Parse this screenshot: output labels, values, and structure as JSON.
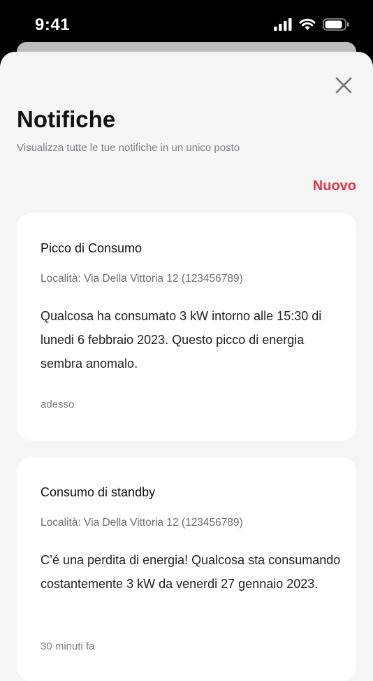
{
  "status_bar": {
    "time": "9:41"
  },
  "header": {
    "title": "Notifiche",
    "subtitle": "Visualizza tutte le tue notifiche in un unico posto",
    "new_label": "Nuovo"
  },
  "notifications": [
    {
      "title": "Picco di Consumo",
      "location": "Località: Via Della Vittoria 12 (123456789)",
      "body": "Qualcosa ha consumato 3 kW intorno alle 15:30 di lunedi 6 febbraio 2023. Questo picco di energia sembra anomalo.",
      "time": "adesso"
    },
    {
      "title": "Consumo di standby",
      "location": "Località: Via Della Vittoria 12 (123456789)",
      "body": "C’é una perdita di energia! Qualcosa sta consumando costantemente 3 kW da venerdi 27 gennaio 2023.",
      "time": "30 minuti fa"
    }
  ],
  "colors": {
    "accent": "#e8344a",
    "sheet_bg": "#f5f5f5",
    "card_bg": "#ffffff"
  },
  "icons": [
    "signal-icon",
    "wifi-icon",
    "battery-icon",
    "close-icon"
  ]
}
